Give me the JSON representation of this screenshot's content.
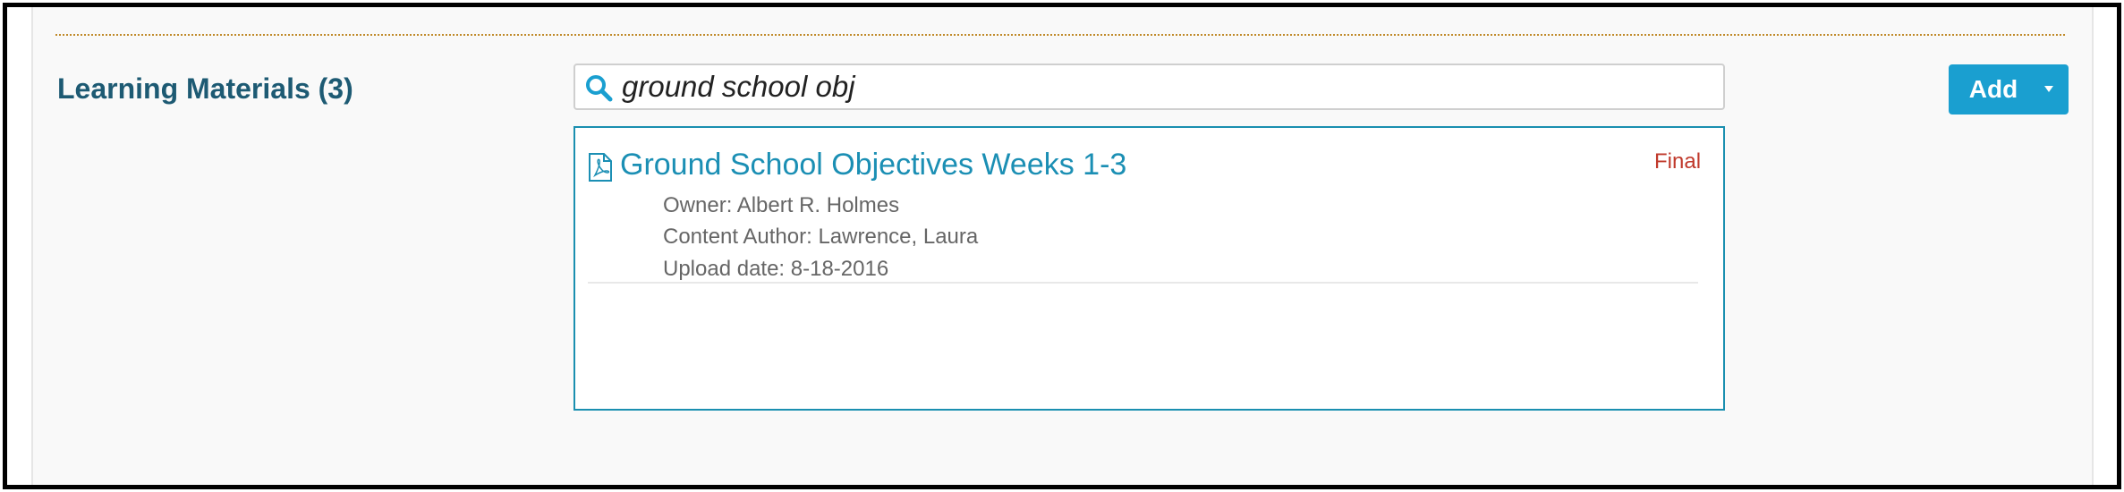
{
  "section": {
    "title": "Learning Materials (3)"
  },
  "search": {
    "query": "ground school obj",
    "icon": "search-icon"
  },
  "add_button": {
    "label": "Add",
    "icon": "caret-down-icon"
  },
  "results": [
    {
      "title": "Ground School Objectives Weeks 1-3",
      "status": "Final",
      "owner": "Owner: Albert R. Holmes",
      "content_author": "Content Author: Lawrence, Laura",
      "upload_date": "Upload date: 8-18-2016",
      "icon": "pdf-file-icon"
    }
  ],
  "colors": {
    "accent": "#1a9fd0",
    "link": "#1b8fb4",
    "title": "#1d5a73",
    "status": "#c0392b",
    "divider": "#c08a2a"
  }
}
